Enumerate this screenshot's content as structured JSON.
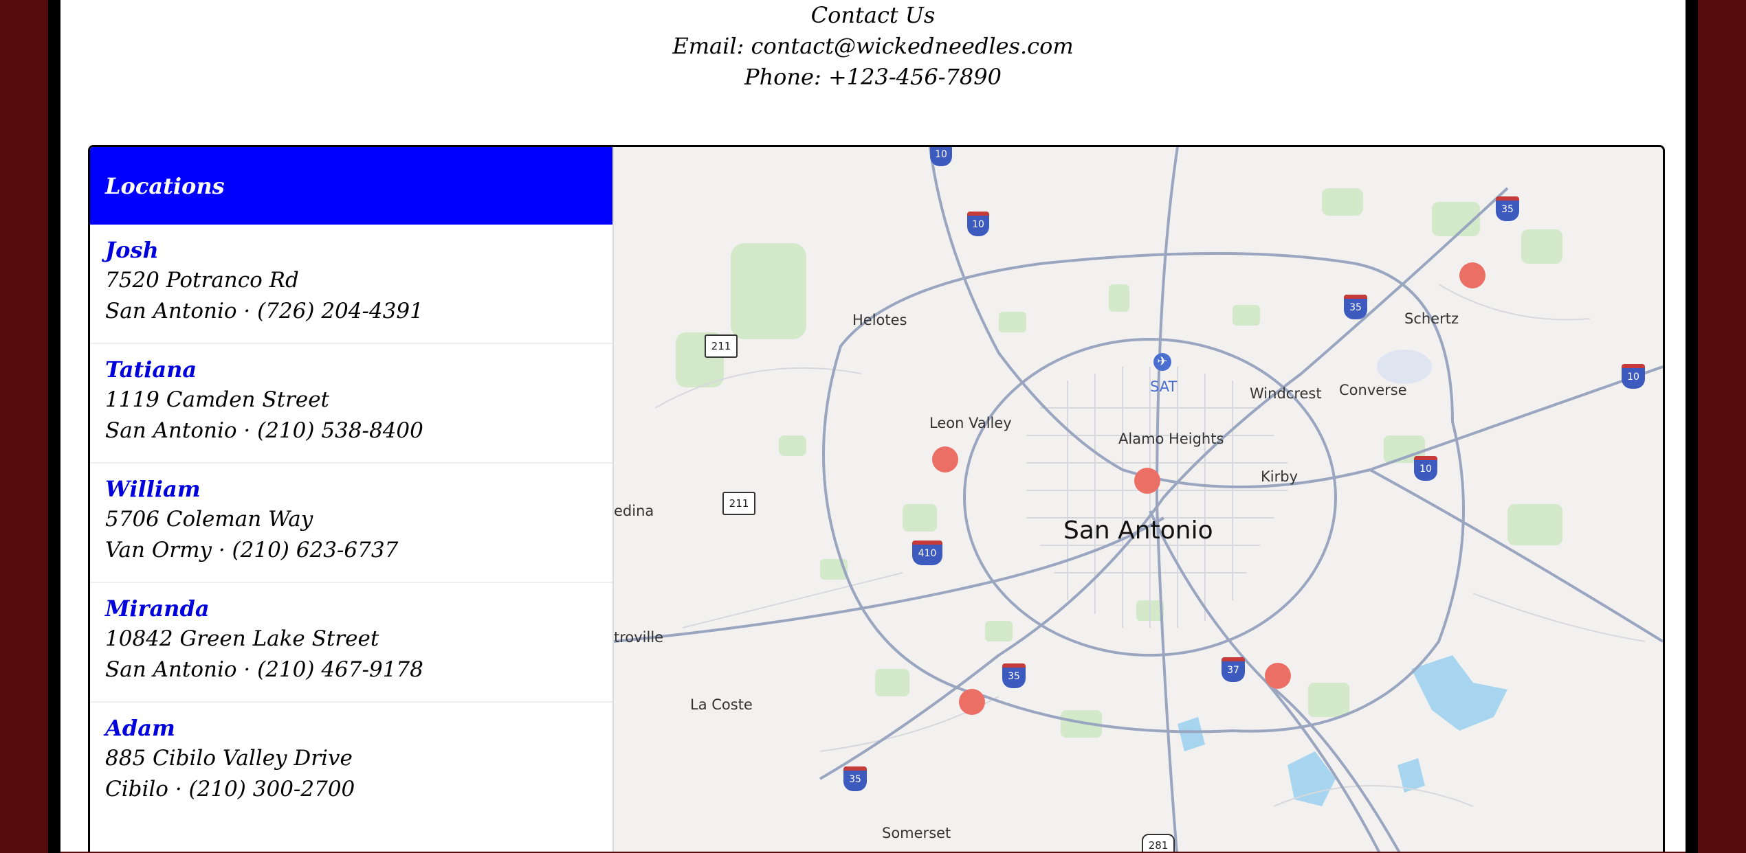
{
  "contact": {
    "title": "Contact Us",
    "email_line": "Email: contact@wickedneedles.com",
    "phone_line": "Phone: +123-456-7890"
  },
  "sidebar": {
    "title": "Locations",
    "locations": [
      {
        "name": "Josh",
        "address": "7520 Potranco Rd",
        "city_phone": "San Antonio · (726) 204-4391"
      },
      {
        "name": "Tatiana",
        "address": "1119 Camden Street",
        "city_phone": "San Antonio · (210) 538-8400"
      },
      {
        "name": "William",
        "address": "5706 Coleman Way",
        "city_phone": "Van Ormy · (210) 623-6737"
      },
      {
        "name": "Miranda",
        "address": "10842 Green Lake Street",
        "city_phone": "San Antonio · (210) 467-9178"
      },
      {
        "name": "Adam",
        "address": "885 Cibilo Valley Drive",
        "city_phone": "Cibilo · (210) 300-2700"
      }
    ]
  },
  "map": {
    "labels": {
      "helotes": "Helotes",
      "leon_valley": "Leon Valley",
      "san_antonio": "San Antonio",
      "alamo_heights": "Alamo Heights",
      "windcrest": "Windcrest",
      "converse": "Converse",
      "schertz": "Schertz",
      "kirby": "Kirby",
      "la_coste": "La Coste",
      "somerset": "Somerset",
      "medina": "edina",
      "castroville": "troville",
      "sat": "SAT"
    },
    "shields": {
      "i10_top": "10",
      "i10_north": "10",
      "i10_east": "10",
      "i10_east2": "10",
      "i35_ne": "35",
      "i35_mid": "35",
      "i35_s": "35",
      "i35_sw": "35",
      "i410": "410",
      "i37": "37",
      "tx211_n": "211",
      "tx211_s": "211",
      "us281": "281"
    }
  },
  "colors": {
    "frame": "#550c0c",
    "header_bg": "#0000ff",
    "name_color": "#0000dd",
    "pin_color": "#ec6f66"
  }
}
